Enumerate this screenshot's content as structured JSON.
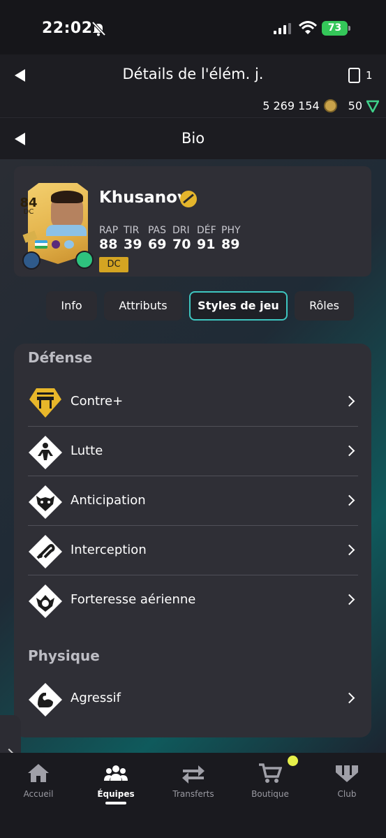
{
  "status_bar": {
    "time": "22:02",
    "battery": "73"
  },
  "header": {
    "title": "Détails de l'élém. j.",
    "card_count": "1",
    "coins": "5 269 154",
    "points": "50"
  },
  "subheader": {
    "title": "Bio"
  },
  "player": {
    "rating": "84",
    "position_short": "DC",
    "name": "Khusanov",
    "stats": [
      {
        "label": "RAP",
        "value": "88"
      },
      {
        "label": "TIR",
        "value": "39"
      },
      {
        "label": "PAS",
        "value": "69"
      },
      {
        "label": "DRI",
        "value": "70"
      },
      {
        "label": "DÉF",
        "value": "91"
      },
      {
        "label": "PHY",
        "value": "89"
      }
    ],
    "position_chip": "DC"
  },
  "tabs": [
    {
      "label": "Info",
      "active": false
    },
    {
      "label": "Attributs",
      "active": false
    },
    {
      "label": "Styles de jeu",
      "active": true
    },
    {
      "label": "Rôles",
      "active": false
    }
  ],
  "sections": [
    {
      "title": "Défense",
      "items": [
        {
          "label": "Contre+",
          "icon": "block-plus-icon",
          "plus": true
        },
        {
          "label": "Lutte",
          "icon": "jockey-icon",
          "plus": false
        },
        {
          "label": "Anticipation",
          "icon": "anticipate-icon",
          "plus": false
        },
        {
          "label": "Interception",
          "icon": "intercept-icon",
          "plus": false
        },
        {
          "label": "Forteresse aérienne",
          "icon": "aerial-fortress-icon",
          "plus": false
        }
      ]
    },
    {
      "title": "Physique",
      "items": [
        {
          "label": "Agressif",
          "icon": "aggressive-icon",
          "plus": false
        }
      ]
    }
  ],
  "bottom_nav": [
    {
      "label": "Accueil",
      "icon": "home-icon",
      "active": false
    },
    {
      "label": "Équipes",
      "icon": "team-icon",
      "active": true
    },
    {
      "label": "Transferts",
      "icon": "transfer-icon",
      "active": false
    },
    {
      "label": "Boutique",
      "icon": "cart-icon",
      "active": false
    },
    {
      "label": "Club",
      "icon": "club-icon",
      "active": false
    }
  ],
  "colors": {
    "accent": "#3ec6c0",
    "gold": "#d4a422",
    "panel": "#2f2f36"
  }
}
